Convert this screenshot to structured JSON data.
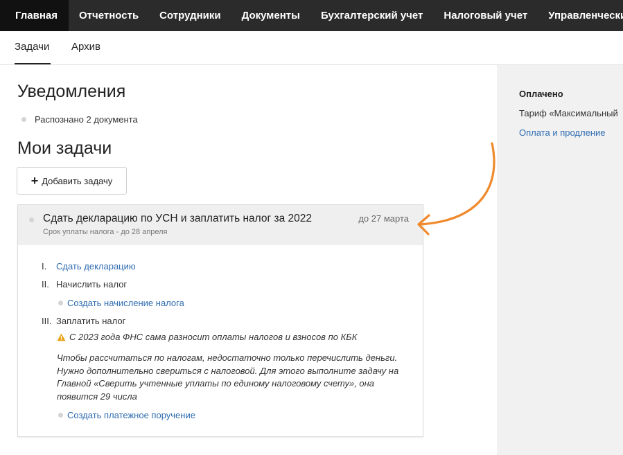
{
  "topnav": {
    "items": [
      "Главная",
      "Отчетность",
      "Сотрудники",
      "Документы",
      "Бухгалтерский учет",
      "Налоговый учет",
      "Управленческие отч"
    ]
  },
  "subtabs": [
    "Задачи",
    "Архив"
  ],
  "notifications": {
    "title": "Уведомления",
    "items": [
      "Распознано 2 документа"
    ]
  },
  "tasks": {
    "title": "Мои задачи",
    "add_button": "Добавить задачу",
    "task": {
      "title": "Сдать декларацию по УСН и заплатить налог за 2022",
      "subtitle": "Срок уплаты налога - до 28 апреля",
      "due": "до 27 марта",
      "steps": [
        {
          "num": "I.",
          "label": "Сдать декларацию"
        },
        {
          "num": "II.",
          "label": "Начислить налог",
          "action": "Создать начисление налога"
        },
        {
          "num": "III.",
          "label": "Заплатить налог",
          "warning": "С 2023 года ФНС сама разносит оплаты налогов и взносов по КБК",
          "note": "Чтобы рассчитаться по налогам, недостаточно только перечислить деньги. Нужно дополнительно свериться с налоговой. Для этого выполните задачу на Главной «Сверить учтенные уплаты по единому налоговому счету», она появится 29 числа",
          "action": "Создать платежное поручение"
        }
      ]
    }
  },
  "sidebar": {
    "status": "Оплачено",
    "tariff": "Тариф «Максимальный",
    "link": "Оплата и продление"
  },
  "colors": {
    "nav_bg": "#2b2b2b",
    "link": "#2d6bb0",
    "annotation_arrow": "#f08a2c",
    "warning": "#e8a417"
  }
}
